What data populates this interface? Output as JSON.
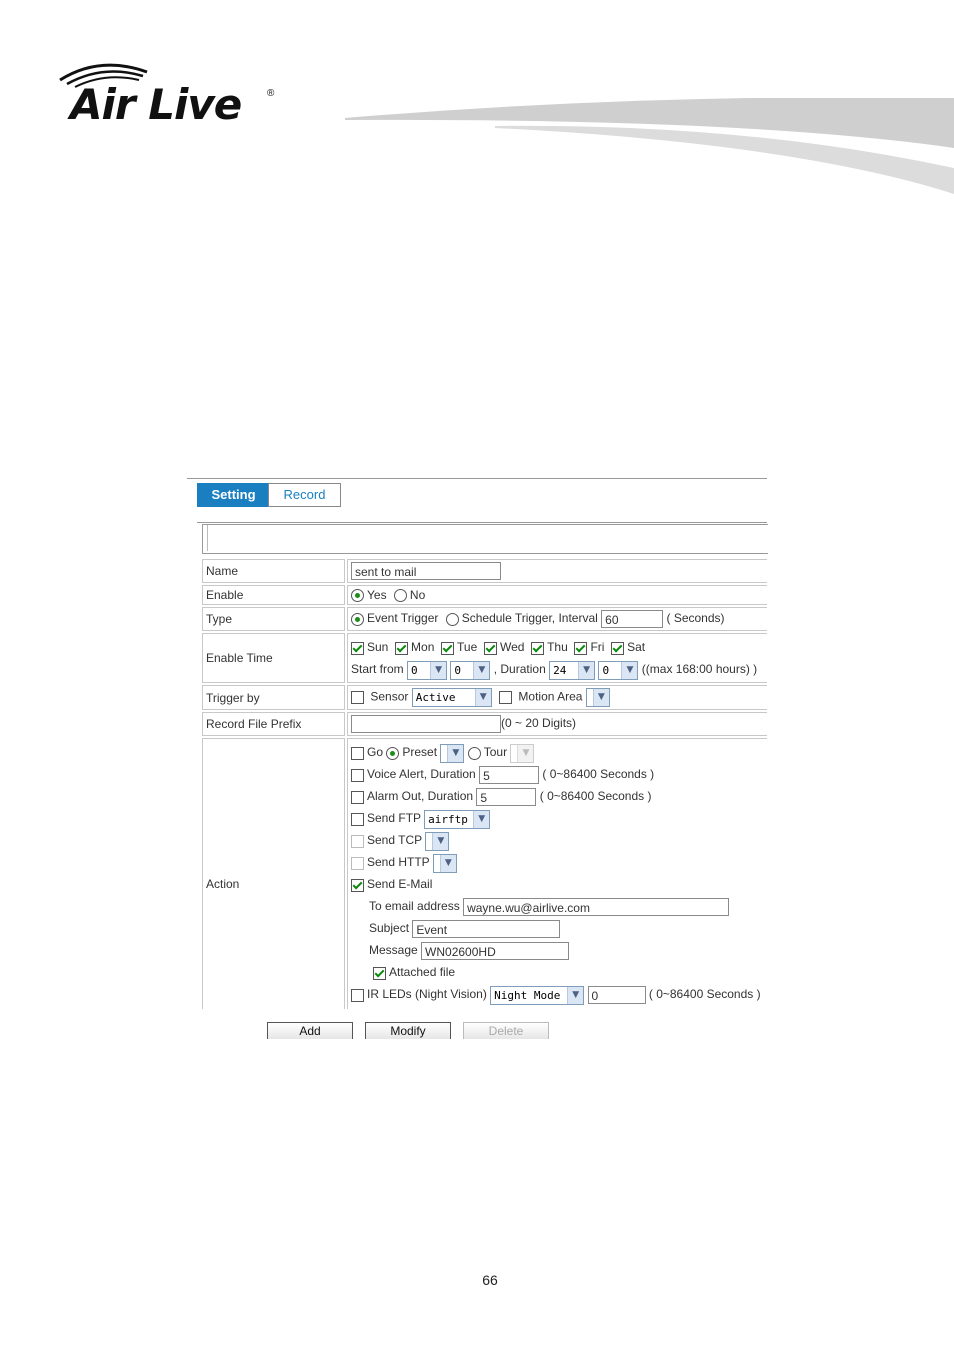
{
  "brand": {
    "logo_text": "Air Live",
    "reg_mark": "®"
  },
  "tabs": [
    {
      "label": "Setting"
    },
    {
      "label": "Record"
    }
  ],
  "form": {
    "name": {
      "label": "Name",
      "value": "sent to mail"
    },
    "enable": {
      "label": "Enable",
      "yes": "Yes",
      "no": "No",
      "selected": "Yes"
    },
    "type": {
      "label": "Type",
      "event_trigger": "Event Trigger",
      "schedule_trigger": "Schedule Trigger, Interval",
      "interval": "60",
      "unit": "( Seconds)",
      "selected": "Event Trigger"
    },
    "enable_time": {
      "label": "Enable Time",
      "days": [
        {
          "label": "Sun",
          "checked": true
        },
        {
          "label": "Mon",
          "checked": true
        },
        {
          "label": "Tue",
          "checked": true
        },
        {
          "label": "Wed",
          "checked": true
        },
        {
          "label": "Thu",
          "checked": true
        },
        {
          "label": "Fri",
          "checked": true
        },
        {
          "label": "Sat",
          "checked": true
        }
      ],
      "start_from_label": "Start from",
      "start_hour": "0",
      "start_min": "0",
      "duration_label": ", Duration",
      "duration_hour": "24",
      "duration_min": "0",
      "max_note": "((max 168:00 hours) )"
    },
    "trigger_by": {
      "label": "Trigger by",
      "sensor": "Sensor",
      "sensor_value": "Active",
      "motion_area": "Motion Area"
    },
    "record_prefix": {
      "label": "Record File Prefix",
      "value": "",
      "hint": "(0 ~ 20 Digits)"
    },
    "action": {
      "label": "Action",
      "go": "Go",
      "preset": "Preset",
      "tour": "Tour",
      "voice_alert": "Voice Alert, Duration",
      "voice_value": "5",
      "voice_range": "( 0~86400 Seconds )",
      "alarm_out": "Alarm Out, Duration",
      "alarm_value": "5",
      "alarm_range": "( 0~86400 Seconds )",
      "send_ftp": "Send FTP",
      "ftp_value": "airftp",
      "send_tcp": "Send TCP",
      "send_http": "Send HTTP",
      "send_email": "Send E-Mail",
      "to_email_label": "To email address",
      "to_email_value": "wayne.wu@airlive.com",
      "subject_label": "Subject",
      "subject_value": "Event",
      "message_label": "Message",
      "message_value": "WN02600HD",
      "attached_file": "Attached file",
      "ir_leds": "IR LEDs (Night Vision)",
      "ir_mode": "Night Mode",
      "ir_value": "0",
      "ir_range": "( 0~86400 Seconds )"
    }
  },
  "buttons": {
    "add": "Add",
    "modify": "Modify",
    "delete": "Delete"
  },
  "page_number": "66",
  "colors": {
    "tab_active_bg": "#1a7fc1",
    "tab_inactive_text": "#1a7fc1",
    "check_green": "#0a8a0a"
  }
}
